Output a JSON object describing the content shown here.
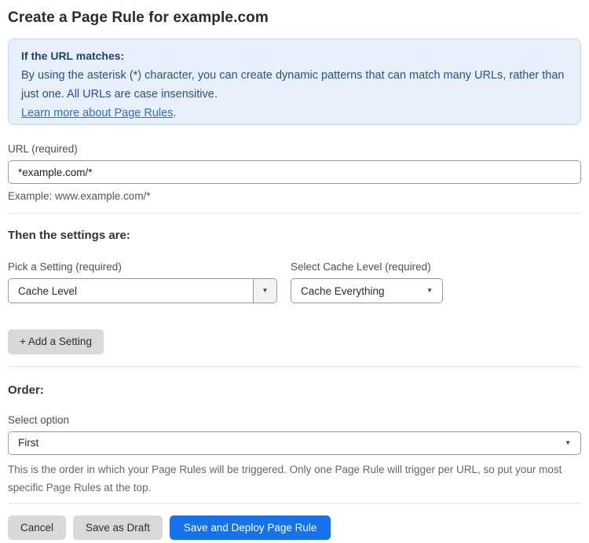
{
  "page": {
    "title": "Create a Page Rule for example.com"
  },
  "info_box": {
    "heading": "If the URL matches:",
    "body": "By using the asterisk (*) character, you can create dynamic patterns that can match many URLs, rather than just one. All URLs are case insensitive.",
    "link_label": "Learn more about Page Rules",
    "link_suffix": "."
  },
  "url_field": {
    "label": "URL (required)",
    "value": "*example.com/*",
    "example": "Example: www.example.com/*"
  },
  "settings": {
    "heading": "Then the settings are:",
    "pick_setting": {
      "label": "Pick a Setting (required)",
      "value": "Cache Level"
    },
    "cache_level": {
      "label": "Select Cache Level (required)",
      "value": "Cache Everything"
    },
    "add_button_label": "+ Add a Setting"
  },
  "order": {
    "heading": "Order:",
    "label": "Select option",
    "value": "First",
    "help": "This is the order in which your Page Rules will be triggered. Only one Page Rule will trigger per URL, so put your most specific Page Rules at the top."
  },
  "actions": {
    "cancel": "Cancel",
    "save_draft": "Save as Draft",
    "save_deploy": "Save and Deploy Page Rule"
  },
  "icons": {
    "dropdown_arrow": "▼"
  },
  "colors": {
    "info_bg": "#e8f1fb",
    "info_border": "#bdd7f3",
    "info_heading": "#1e3f7d",
    "info_text": "#2e4d8d",
    "link": "#2d6ccb",
    "primary_button": "#1672e6",
    "secondary_button": "#d9d9d9"
  }
}
